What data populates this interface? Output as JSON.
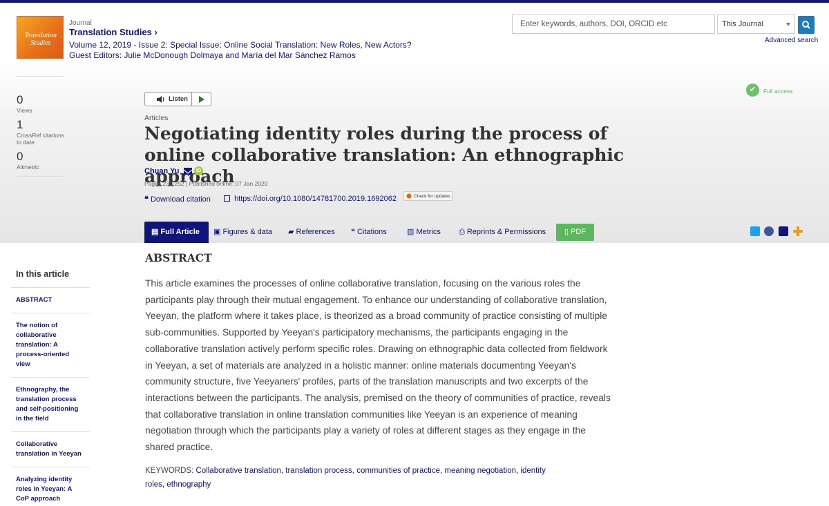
{
  "journal": {
    "cover_line1": "Translation",
    "cover_line2": "Studies",
    "label": "Journal",
    "name": "Translation Studies ›",
    "issue": "Volume 12, 2019 - Issue 2: Special Issue: Online Social Translation: New Roles, New Actors? Guest Editors: Julie McDonough Dolmaya and María del Mar Sánchez Ramos"
  },
  "search": {
    "placeholder": "Enter keywords, authors, DOI, ORCID etc",
    "scope": "This Journal",
    "advanced": "Advanced search"
  },
  "metrics": [
    {
      "value": "0",
      "label": "Views"
    },
    {
      "value": "1",
      "label": "CrossRef citations to date"
    },
    {
      "value": "0",
      "label": "Altmetric"
    }
  ],
  "listen": {
    "label": "Listen"
  },
  "article": {
    "type": "Articles",
    "title": "Negotiating identity roles during the process of online collaborative translation: An ethnographic approach",
    "author": "Chuan Yu",
    "pages_published": "Pages 231-252 | Published online: 07 Jan 2020",
    "download_citation": "Download citation",
    "doi": "https://doi.org/10.1080/14781700.2019.1692062",
    "check_updates": "Check for updates",
    "access": "Full access"
  },
  "tabs": [
    {
      "label": "Full Article"
    },
    {
      "label": "Figures & data"
    },
    {
      "label": "References"
    },
    {
      "label": "Citations"
    },
    {
      "label": "Metrics"
    },
    {
      "label": "Reprints & Permissions"
    },
    {
      "label": "PDF"
    }
  ],
  "sidebar": {
    "heading": "In this article",
    "items": [
      {
        "label": "ABSTRACT"
      },
      {
        "label": "The notion of collaborative translation: A process-oriented view"
      },
      {
        "label": "Ethnography, the translation process and self-positioning in the field"
      },
      {
        "label": "Collaborative translation in Yeeyan"
      },
      {
        "label": "Analyzing identity roles in Yeeyan: A CoP approach"
      }
    ]
  },
  "abstract": {
    "heading": "ABSTRACT",
    "text": "This article examines the processes of online collaborative translation, focusing on the various roles the participants play through their mutual engagement. To enhance our understanding of collaborative translation, Yeeyan, the platform where it takes place, is theorized as a broad community of practice consisting of multiple sub-communities. Supported by Yeeyan's participatory mechanisms, the participants engaging in the collaborative translation actively perform specific roles. Drawing on ethnographic data collected from fieldwork in Yeeyan, a set of materials are analyzed in a holistic manner: online materials documenting Yeeyan's community structure, five Yeeyaners' profiles, parts of the translation manuscripts and two excerpts of the interactions between the participants. The analysis, premised on the theory of communities of practice, reveals that collaborative translation in online translation communities like Yeeyan is an experience of meaning negotiation through which the participants play a variety of roles at different stages as they engage in the shared practice."
  },
  "keywords": {
    "label": "KEYWORDS:",
    "items": [
      "Collaborative translation,",
      "translation process,",
      "communities of practice,",
      "meaning negotiation,",
      "identity roles,",
      "ethnography"
    ]
  },
  "colors": {
    "brand": "#10147e",
    "accent_green": "#5cb85c",
    "search_blue": "#1c7bbf"
  }
}
